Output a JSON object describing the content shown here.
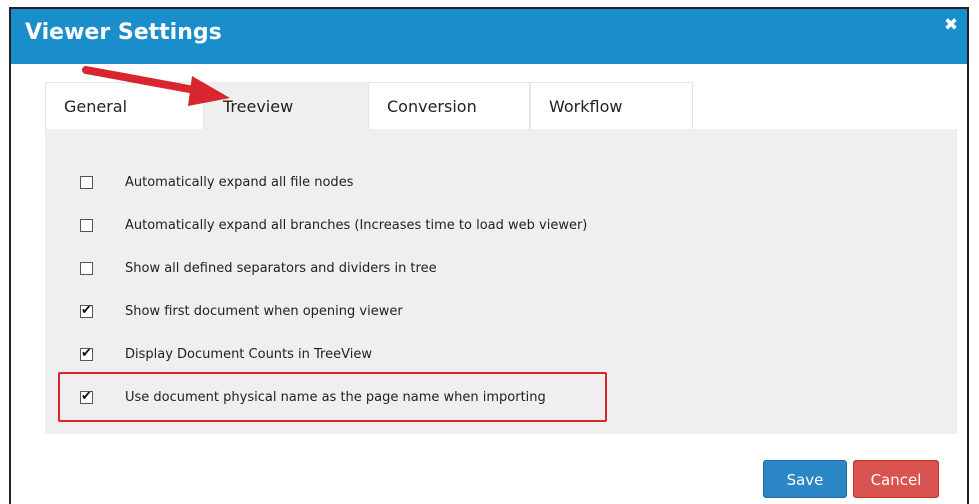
{
  "dialog": {
    "title": "Viewer Settings",
    "close_icon": "close-icon"
  },
  "tabs": [
    {
      "label": "General",
      "active": false
    },
    {
      "label": "Treeview",
      "active": true
    },
    {
      "label": "Conversion",
      "active": false
    },
    {
      "label": "Workflow",
      "active": false
    }
  ],
  "options": [
    {
      "label": "Automatically expand all file nodes",
      "checked": false
    },
    {
      "label": "Automatically expand all branches (Increases time to load web viewer)",
      "checked": false
    },
    {
      "label": "Show all defined separators and dividers in tree",
      "checked": false
    },
    {
      "label": "Show first document when opening viewer",
      "checked": true
    },
    {
      "label": "Display Document Counts in TreeView",
      "checked": true
    },
    {
      "label": "Use document physical name as the page name when importing",
      "checked": true
    }
  ],
  "buttons": {
    "save_label": "Save",
    "cancel_label": "Cancel"
  },
  "colors": {
    "titlebar": "#1a8ecb",
    "annotation": "#d9262e",
    "save": "#2a86c4",
    "cancel": "#d9534f"
  }
}
